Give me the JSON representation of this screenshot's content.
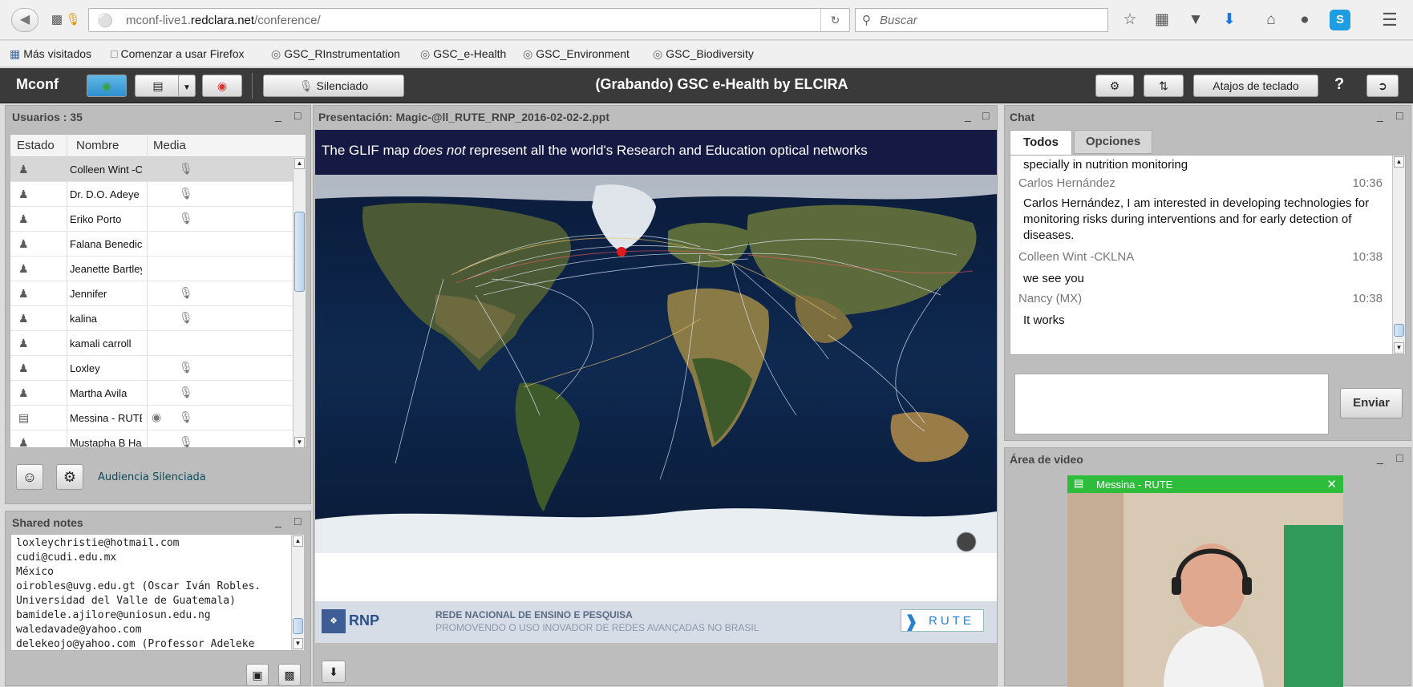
{
  "browser": {
    "url_prefix": "mconf-live1.",
    "url_domain": "redclara.net",
    "url_path": "/conference/",
    "search_placeholder": "Buscar",
    "bookmarks": [
      "Más visitados",
      "Comenzar a usar Firefox",
      "GSC_RInstrumentation",
      "GSC_e-Health",
      "GSC_Environment",
      "GSC_Biodiversity"
    ]
  },
  "toolbar": {
    "logo": "Mconf",
    "mute_label": "Silenciado",
    "title": "(Grabando) GSC e-Health by ELCIRA",
    "shortcuts_label": "Atajos de teclado",
    "help_label": "?"
  },
  "users": {
    "title": "Usuarios : 35",
    "columns": [
      "Estado",
      "Nombre",
      "Media"
    ],
    "rows": [
      {
        "name": "Colleen Wint -C"
      },
      {
        "name": "Dr. D.O. Adeye"
      },
      {
        "name": "Eriko Porto"
      },
      {
        "name": "Falana Benedic"
      },
      {
        "name": "Jeanette Bartley"
      },
      {
        "name": "Jennifer"
      },
      {
        "name": "kalina"
      },
      {
        "name": "kamali carroll"
      },
      {
        "name": "Loxley"
      },
      {
        "name": "Martha Avila"
      },
      {
        "name": "Messina - RUTE"
      },
      {
        "name": "Mustapha B Ha"
      }
    ],
    "audience_status": "Audiencia Silenciada"
  },
  "notes": {
    "title": "Shared notes",
    "lines": [
      "loxleychristie@hotmail.com",
      "cudi@cudi.edu.mx",
      "México",
      "oirobles@uvg.edu.gt (Oscar Iván Robles.",
      "Universidad del Valle de Guatemala)",
      "bamidele.ajilore@uniosun.edu.ng",
      "waledavade@yahoo.com",
      "delekeojo@yahoo.com (Professor Adeleke"
    ]
  },
  "presentation": {
    "title": "Presentación: Magic-@ll_RUTE_RNP_2016-02-02-2.ppt",
    "slide_heading_part1": "The GLIF map ",
    "slide_heading_italic": "does not",
    "slide_heading_part2": " represent all the world's Research and Education optical networks",
    "footer_logo_left": "RNP",
    "footer_line1": "REDE NACIONAL DE ENSINO E PESQUISA",
    "footer_line2": "PROMOVENDO O USO INOVADOR DE REDES AVANÇADAS NO BRASIL",
    "footer_logo_right": "RUTE"
  },
  "chat": {
    "title": "Chat",
    "tabs": [
      "Todos",
      "Opciones"
    ],
    "first_line": "specially in nutrition monitoring",
    "messages": [
      {
        "name": "Carlos Hernández",
        "time": "10:36",
        "text": "Carlos Hernández, I am interested in developing technologies for monitoring risks during interventions and for early detection of diseases."
      },
      {
        "name": "Colleen Wint -CKLNA",
        "time": "10:38",
        "text": "we see you"
      },
      {
        "name": "Nancy (MX)",
        "time": "10:38",
        "text": "It works"
      }
    ],
    "send_label": "Enviar"
  },
  "video": {
    "title": "Área de video",
    "participant": "Messina - RUTE"
  }
}
